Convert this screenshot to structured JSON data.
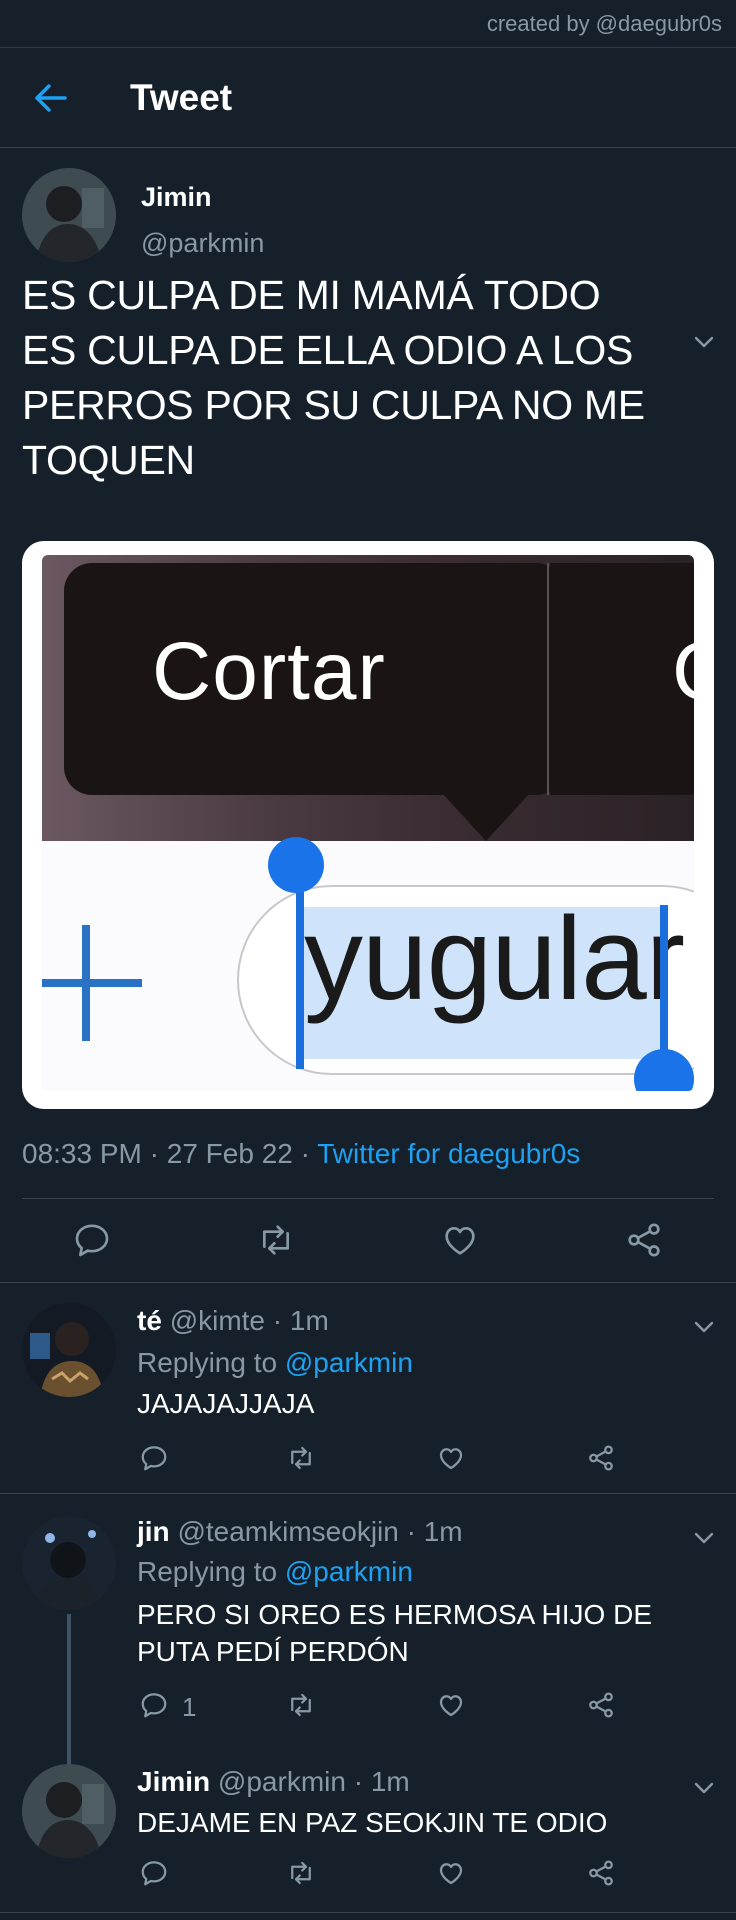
{
  "credit": "created by @daegubr0s",
  "header": {
    "title": "Tweet"
  },
  "tweet": {
    "name": "Jimin",
    "handle": "@parkmin",
    "text_lines": [
      "ES CULPA DE MI MAMÁ TODO",
      "ES CULPA DE ELLA ODIO A LOS",
      "PERROS POR SU CULPA NO ME",
      "TOQUEN"
    ],
    "media": {
      "menu_label": "Cortar",
      "menu_partial": "C",
      "field_text": "yugular"
    },
    "time": "08:33 PM",
    "date": "27 Feb 22",
    "source": "Twitter for daegubr0s",
    "separator": "·"
  },
  "replies": [
    {
      "name": "té",
      "handle": "@kimte",
      "time": "· 1m",
      "replying_label": "Replying to",
      "replying_to": "@parkmin",
      "text": "JAJAJAJJAJA",
      "reply_count": ""
    },
    {
      "name": "jin",
      "handle": "@teamkimseokjin",
      "time": "· 1m",
      "replying_label": "Replying to",
      "replying_to": "@parkmin",
      "text": "PERO SI OREO ES HERMOSA HIJO DE PUTA PEDÍ PERDÓN",
      "reply_count": "1"
    },
    {
      "name": "Jimin",
      "handle": "@parkmin",
      "time": "· 1m",
      "text": "DEJAME EN PAZ SEOKJIN TE ODIO",
      "reply_count": ""
    }
  ],
  "colors": {
    "background": "#15202b",
    "accent": "#1da1f2",
    "muted": "#8899a6",
    "divider": "#38444d"
  },
  "icons": [
    "back-arrow-icon",
    "chevron-down-icon",
    "reply-icon",
    "retweet-icon",
    "like-icon",
    "share-icon"
  ]
}
